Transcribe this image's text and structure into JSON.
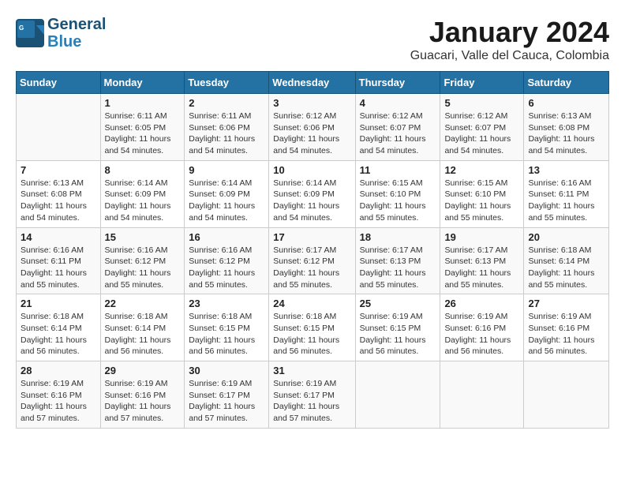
{
  "header": {
    "logo_line1": "General",
    "logo_line2": "Blue",
    "month_title": "January 2024",
    "location": "Guacari, Valle del Cauca, Colombia"
  },
  "days_of_week": [
    "Sunday",
    "Monday",
    "Tuesday",
    "Wednesday",
    "Thursday",
    "Friday",
    "Saturday"
  ],
  "weeks": [
    [
      {
        "day": "",
        "empty": true
      },
      {
        "day": "1",
        "sunrise": "6:11 AM",
        "sunset": "6:05 PM",
        "daylight": "11 hours and 54 minutes."
      },
      {
        "day": "2",
        "sunrise": "6:11 AM",
        "sunset": "6:06 PM",
        "daylight": "11 hours and 54 minutes."
      },
      {
        "day": "3",
        "sunrise": "6:12 AM",
        "sunset": "6:06 PM",
        "daylight": "11 hours and 54 minutes."
      },
      {
        "day": "4",
        "sunrise": "6:12 AM",
        "sunset": "6:07 PM",
        "daylight": "11 hours and 54 minutes."
      },
      {
        "day": "5",
        "sunrise": "6:12 AM",
        "sunset": "6:07 PM",
        "daylight": "11 hours and 54 minutes."
      },
      {
        "day": "6",
        "sunrise": "6:13 AM",
        "sunset": "6:08 PM",
        "daylight": "11 hours and 54 minutes."
      }
    ],
    [
      {
        "day": "7",
        "sunrise": "6:13 AM",
        "sunset": "6:08 PM",
        "daylight": "11 hours and 54 minutes."
      },
      {
        "day": "8",
        "sunrise": "6:14 AM",
        "sunset": "6:09 PM",
        "daylight": "11 hours and 54 minutes."
      },
      {
        "day": "9",
        "sunrise": "6:14 AM",
        "sunset": "6:09 PM",
        "daylight": "11 hours and 54 minutes."
      },
      {
        "day": "10",
        "sunrise": "6:14 AM",
        "sunset": "6:09 PM",
        "daylight": "11 hours and 54 minutes."
      },
      {
        "day": "11",
        "sunrise": "6:15 AM",
        "sunset": "6:10 PM",
        "daylight": "11 hours and 55 minutes."
      },
      {
        "day": "12",
        "sunrise": "6:15 AM",
        "sunset": "6:10 PM",
        "daylight": "11 hours and 55 minutes."
      },
      {
        "day": "13",
        "sunrise": "6:16 AM",
        "sunset": "6:11 PM",
        "daylight": "11 hours and 55 minutes."
      }
    ],
    [
      {
        "day": "14",
        "sunrise": "6:16 AM",
        "sunset": "6:11 PM",
        "daylight": "11 hours and 55 minutes."
      },
      {
        "day": "15",
        "sunrise": "6:16 AM",
        "sunset": "6:12 PM",
        "daylight": "11 hours and 55 minutes."
      },
      {
        "day": "16",
        "sunrise": "6:16 AM",
        "sunset": "6:12 PM",
        "daylight": "11 hours and 55 minutes."
      },
      {
        "day": "17",
        "sunrise": "6:17 AM",
        "sunset": "6:12 PM",
        "daylight": "11 hours and 55 minutes."
      },
      {
        "day": "18",
        "sunrise": "6:17 AM",
        "sunset": "6:13 PM",
        "daylight": "11 hours and 55 minutes."
      },
      {
        "day": "19",
        "sunrise": "6:17 AM",
        "sunset": "6:13 PM",
        "daylight": "11 hours and 55 minutes."
      },
      {
        "day": "20",
        "sunrise": "6:18 AM",
        "sunset": "6:14 PM",
        "daylight": "11 hours and 55 minutes."
      }
    ],
    [
      {
        "day": "21",
        "sunrise": "6:18 AM",
        "sunset": "6:14 PM",
        "daylight": "11 hours and 56 minutes."
      },
      {
        "day": "22",
        "sunrise": "6:18 AM",
        "sunset": "6:14 PM",
        "daylight": "11 hours and 56 minutes."
      },
      {
        "day": "23",
        "sunrise": "6:18 AM",
        "sunset": "6:15 PM",
        "daylight": "11 hours and 56 minutes."
      },
      {
        "day": "24",
        "sunrise": "6:18 AM",
        "sunset": "6:15 PM",
        "daylight": "11 hours and 56 minutes."
      },
      {
        "day": "25",
        "sunrise": "6:19 AM",
        "sunset": "6:15 PM",
        "daylight": "11 hours and 56 minutes."
      },
      {
        "day": "26",
        "sunrise": "6:19 AM",
        "sunset": "6:16 PM",
        "daylight": "11 hours and 56 minutes."
      },
      {
        "day": "27",
        "sunrise": "6:19 AM",
        "sunset": "6:16 PM",
        "daylight": "11 hours and 56 minutes."
      }
    ],
    [
      {
        "day": "28",
        "sunrise": "6:19 AM",
        "sunset": "6:16 PM",
        "daylight": "11 hours and 57 minutes."
      },
      {
        "day": "29",
        "sunrise": "6:19 AM",
        "sunset": "6:16 PM",
        "daylight": "11 hours and 57 minutes."
      },
      {
        "day": "30",
        "sunrise": "6:19 AM",
        "sunset": "6:17 PM",
        "daylight": "11 hours and 57 minutes."
      },
      {
        "day": "31",
        "sunrise": "6:19 AM",
        "sunset": "6:17 PM",
        "daylight": "11 hours and 57 minutes."
      },
      {
        "day": "",
        "empty": true
      },
      {
        "day": "",
        "empty": true
      },
      {
        "day": "",
        "empty": true
      }
    ]
  ]
}
